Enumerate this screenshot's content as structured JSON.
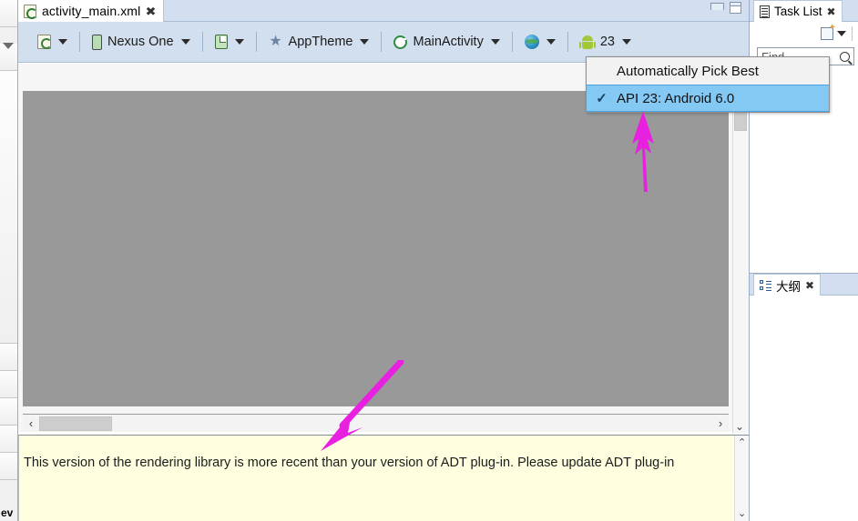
{
  "editor": {
    "tab": {
      "title": "activity_main.xml",
      "icon": "xml-layout-icon",
      "close": "✖"
    },
    "window_controls": {
      "minimize": "minimize-icon",
      "maximize": "maximize-icon"
    }
  },
  "toolbar": {
    "items": [
      {
        "name": "layout-config",
        "icon": "layout-icon",
        "label": "",
        "caret": true
      },
      {
        "name": "device",
        "icon": "device-icon",
        "label": "Nexus One",
        "caret": true
      },
      {
        "name": "orientation",
        "icon": "orientation-icon",
        "label": "",
        "caret": true
      },
      {
        "name": "theme",
        "icon": "star-icon",
        "label": "AppTheme",
        "caret": true
      },
      {
        "name": "activity",
        "icon": "activity-icon",
        "label": "MainActivity",
        "caret": true
      },
      {
        "name": "locale",
        "icon": "globe-icon",
        "label": "",
        "caret": true
      },
      {
        "name": "api-level",
        "icon": "android-icon",
        "label": "23",
        "caret": true
      }
    ]
  },
  "api_menu": {
    "items": [
      {
        "label": "Automatically Pick Best",
        "checked": false,
        "selected": false
      },
      {
        "label": "API 23: Android 6.0",
        "checked": true,
        "selected": true
      }
    ],
    "check_glyph": "✓",
    "highlight_color": "#84c8f4"
  },
  "canvas": {
    "background_color": "#999999",
    "hscroll": {
      "left_arrow": "‹",
      "right_arrow": "›"
    },
    "vscroll": {
      "down_arrow": "⌄"
    }
  },
  "error_panel": {
    "message": "This version of the rendering library is more recent than your version of ADT plug-in. Please update ADT plug-in",
    "background_color": "#ffffdf",
    "scroll_up": "⌃",
    "scroll_down": "⌄"
  },
  "left_palette": {
    "bottom_label": "ev",
    "caret": "collapse-caret-icon"
  },
  "right_dock": {
    "task_list": {
      "title": "Task List",
      "icon": "task-list-icon",
      "close": "✖",
      "new_task_icon": "new-task-icon",
      "menu_caret": "chevron-down-icon",
      "find_placeholder": "Find"
    },
    "outline": {
      "title": "大纲",
      "icon": "outline-icon",
      "close": "✖"
    }
  },
  "annotations": {
    "arrow_color": "#e820e0",
    "arrows": [
      {
        "name": "arrow-to-api-menu",
        "points_to": "API 23: Android 6.0"
      },
      {
        "name": "arrow-to-error-message",
        "points_to": "rendering library message"
      }
    ]
  }
}
